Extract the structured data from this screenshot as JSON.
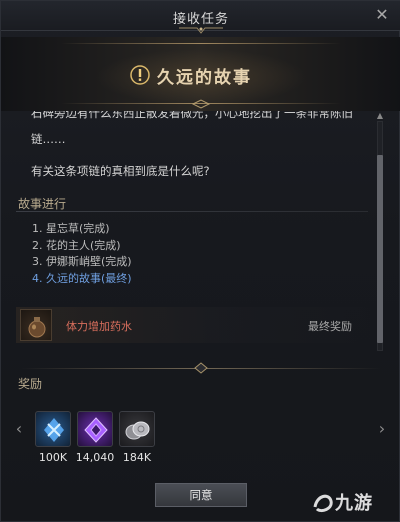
{
  "window": {
    "title": "接收任务",
    "close_glyph": "✕"
  },
  "quest": {
    "title": "久远的故事",
    "icon": "quest-exclamation-icon",
    "story_cut_line": "石碑旁边有什么东西正散发着微光，小心地挖出了一条非常陈旧的项",
    "story_line2": "链……",
    "story_question": "有关这条项链的真相到底是什么呢?"
  },
  "progress": {
    "label": "故事进行",
    "steps": [
      {
        "text": "1. 星忘草(完成)"
      },
      {
        "text": "2. 花的主人(完成)"
      },
      {
        "text": "3. 伊娜斯峭壁(完成)"
      },
      {
        "text": "4. 久远的故事(最终)"
      }
    ]
  },
  "final_item": {
    "name": "体力增加药水",
    "tag": "最终奖励",
    "icon": "potion-bag-icon"
  },
  "rewards": {
    "label": "奖励",
    "items": [
      {
        "value": "100K",
        "icon": "blue-crystal-icon"
      },
      {
        "value": "14,040",
        "icon": "purple-gem-icon"
      },
      {
        "value": "184K",
        "icon": "silver-coins-icon"
      }
    ],
    "prev_glyph": "‹",
    "next_glyph": "›"
  },
  "actions": {
    "agree_label": "同意"
  },
  "watermark": {
    "text": "九游"
  },
  "colors": {
    "accent_gold": "#e6d3b0",
    "current_step": "#6f9fe0",
    "potion_red": "#d86e5c"
  }
}
